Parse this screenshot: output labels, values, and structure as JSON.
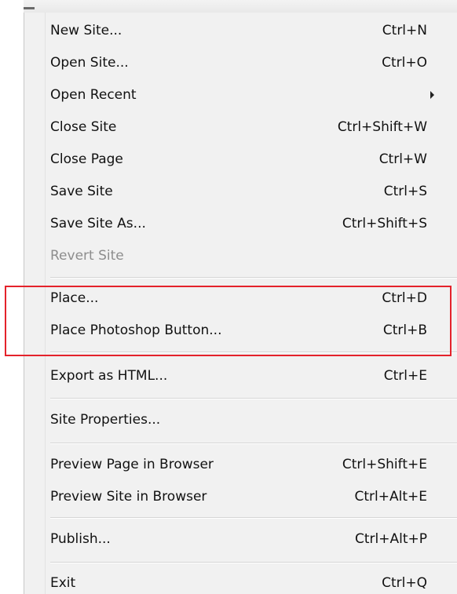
{
  "menu": {
    "items": [
      {
        "label": "New Site...",
        "shortcut": "Ctrl+N"
      },
      {
        "label": "Open Site...",
        "shortcut": "Ctrl+O"
      },
      {
        "label": "Open Recent",
        "shortcut": ""
      },
      {
        "label": "Close Site",
        "shortcut": "Ctrl+Shift+W"
      },
      {
        "label": "Close Page",
        "shortcut": "Ctrl+W"
      },
      {
        "label": "Save Site",
        "shortcut": "Ctrl+S"
      },
      {
        "label": "Save Site As...",
        "shortcut": "Ctrl+Shift+S"
      },
      {
        "label": "Revert Site",
        "shortcut": ""
      },
      {
        "label": "Place...",
        "shortcut": "Ctrl+D"
      },
      {
        "label": "Place Photoshop Button...",
        "shortcut": "Ctrl+B"
      },
      {
        "label": "Export as HTML...",
        "shortcut": "Ctrl+E"
      },
      {
        "label": "Site Properties...",
        "shortcut": ""
      },
      {
        "label": "Preview Page in Browser",
        "shortcut": "Ctrl+Shift+E"
      },
      {
        "label": "Preview Site in Browser",
        "shortcut": "Ctrl+Alt+E"
      },
      {
        "label": "Publish...",
        "shortcut": "Ctrl+Alt+P"
      },
      {
        "label": "Exit",
        "shortcut": "Ctrl+Q"
      }
    ]
  },
  "colors": {
    "highlight_border": "#e4222b",
    "disabled_text": "#8d8d8d",
    "menu_background": "#f1f1f1"
  },
  "icons": {
    "submenu": "chevron-right-icon"
  }
}
